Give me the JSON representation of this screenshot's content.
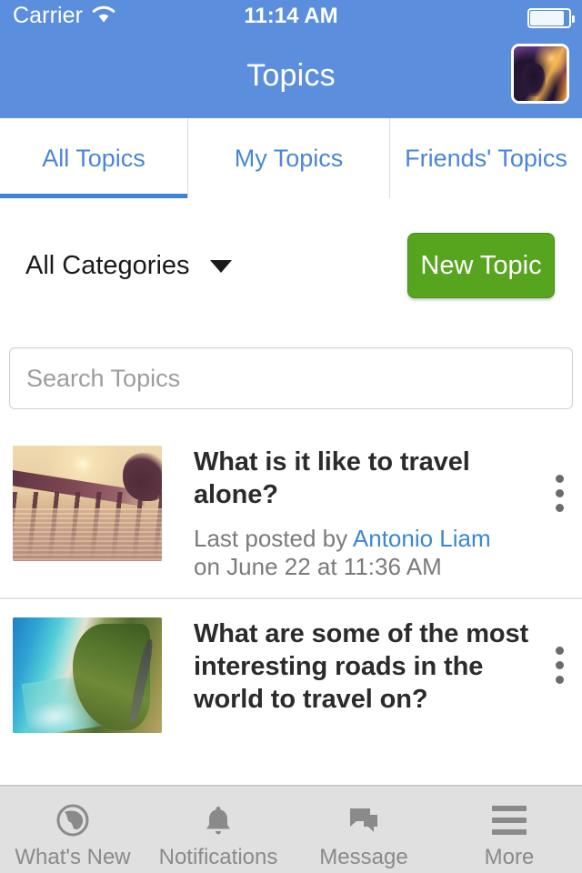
{
  "status_bar": {
    "carrier": "Carrier",
    "wifi_icon": "wifi-icon",
    "time": "11:14 AM",
    "battery_icon": "battery-icon"
  },
  "nav_bar": {
    "title": "Topics",
    "avatar_icon": "user-avatar"
  },
  "tabs": [
    {
      "label": "All Topics",
      "active": true
    },
    {
      "label": "My Topics",
      "active": false
    },
    {
      "label": "Friends' Topics",
      "active": false
    }
  ],
  "filter_row": {
    "category_label": "All Categories",
    "caret_icon": "chevron-down-icon",
    "new_topic_label": "New Topic"
  },
  "search": {
    "placeholder": "Search Topics",
    "value": ""
  },
  "topics": [
    {
      "title": "What is it like to travel alone?",
      "meta_prefix": "Last posted by ",
      "author": "Antonio Liam",
      "meta_suffix": "on June 22 at 11:36 AM",
      "thumbnail": "pier-at-sunset-photo",
      "menu_icon": "kebab-menu-icon"
    },
    {
      "title": "What are some of the most interesting roads in the world to travel on?",
      "meta_prefix": "",
      "author": "",
      "meta_suffix": "",
      "thumbnail": "coastal-road-photo",
      "menu_icon": "kebab-menu-icon"
    }
  ],
  "bottom_nav": [
    {
      "label": "What's New",
      "icon": "globe-icon"
    },
    {
      "label": "Notifications",
      "icon": "bell-icon"
    },
    {
      "label": "Message",
      "icon": "chat-bubbles-icon"
    },
    {
      "label": "More",
      "icon": "hamburger-menu-icon"
    }
  ],
  "colors": {
    "header_blue": "#5b8fdd",
    "tab_blue": "#4a86d8",
    "active_underline": "#3f83d9",
    "new_topic_green": "#57a51e",
    "link_blue": "#3d86d0",
    "bottom_nav_gray": "#e0e0e0"
  }
}
